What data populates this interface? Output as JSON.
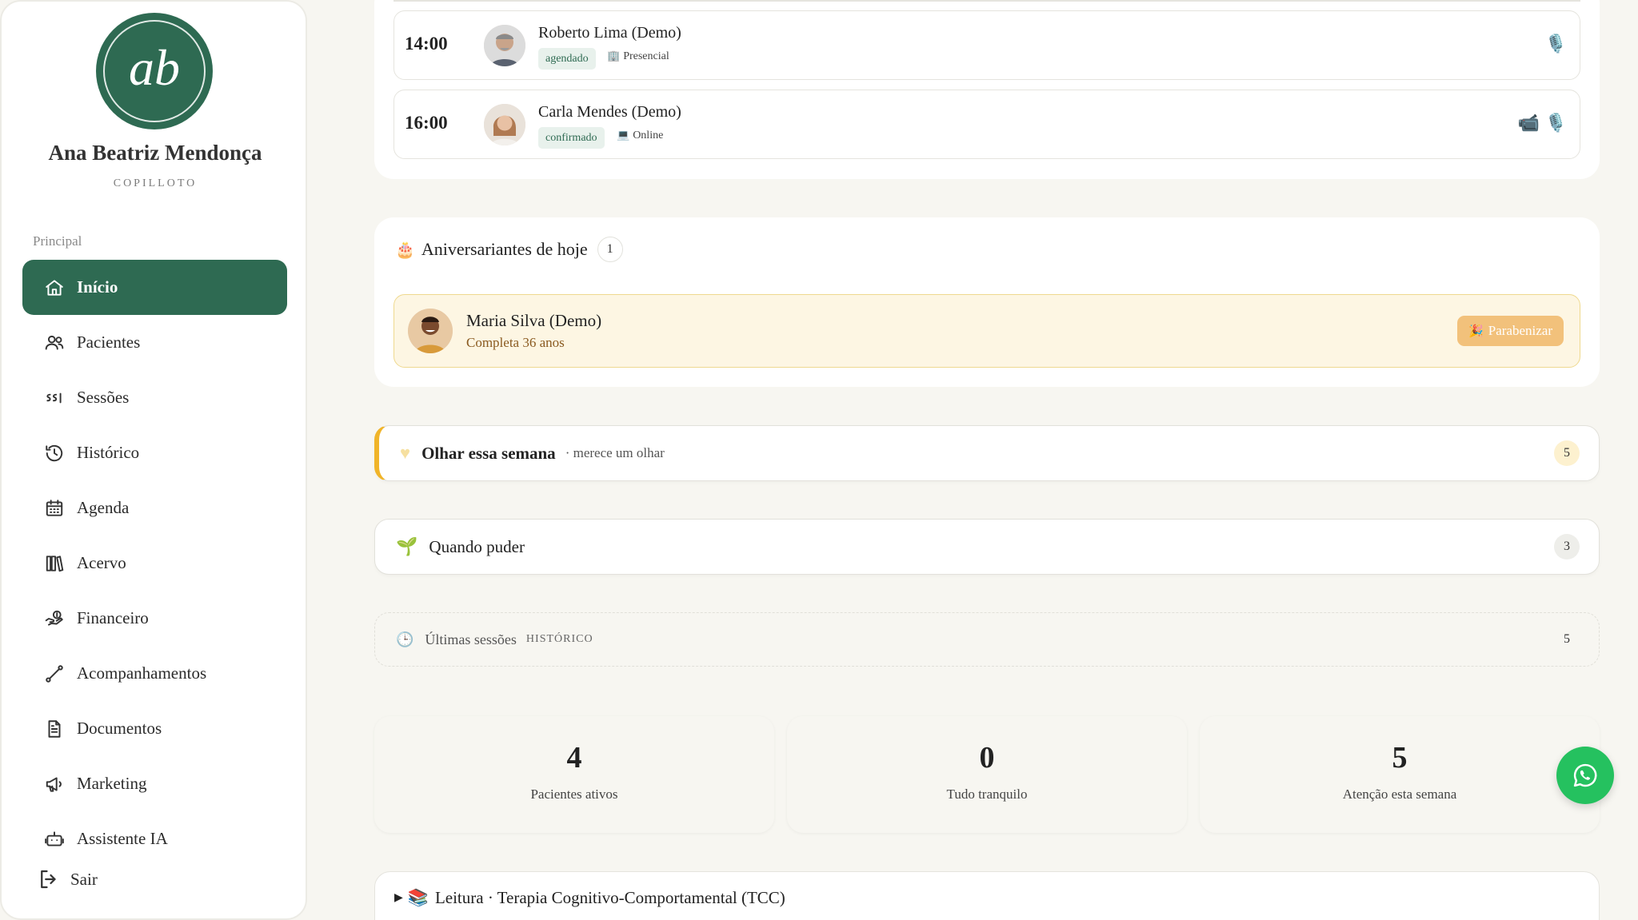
{
  "sidebar": {
    "logo_initials": "ab",
    "user_name": "Ana Beatriz Mendonça",
    "user_role": "COPILLOTO",
    "section_label": "Principal",
    "items": [
      {
        "label": "Início",
        "icon": "home-icon",
        "active": true
      },
      {
        "label": "Pacientes",
        "icon": "users-icon"
      },
      {
        "label": "Sessões",
        "icon": "sessions-icon"
      },
      {
        "label": "Histórico",
        "icon": "history-icon"
      },
      {
        "label": "Agenda",
        "icon": "calendar-icon"
      },
      {
        "label": "Acervo",
        "icon": "library-icon"
      },
      {
        "label": "Financeiro",
        "icon": "finance-icon"
      },
      {
        "label": "Acompanhamentos",
        "icon": "route-icon"
      },
      {
        "label": "Documentos",
        "icon": "document-icon"
      },
      {
        "label": "Marketing",
        "icon": "megaphone-icon"
      },
      {
        "label": "Assistente IA",
        "icon": "robot-icon"
      }
    ],
    "logout_label": "Sair"
  },
  "appointments": [
    {
      "time": "14:00",
      "name": "Roberto Lima (Demo)",
      "status": "agendado",
      "mode": "Presencial",
      "mode_icon": "🏢"
    },
    {
      "time": "16:00",
      "name": "Carla Mendes (Demo)",
      "status": "confirmado",
      "mode": "Online",
      "mode_icon": "💻"
    }
  ],
  "birthdays": {
    "title": "Aniversariantes de hoje",
    "count": "1",
    "person": {
      "name": "Maria Silva (Demo)",
      "detail": "Completa 36 anos"
    },
    "button_label": "Parabenizar"
  },
  "panels": {
    "week": {
      "title": "Olhar essa semana",
      "subtitle": "· merece um olhar",
      "count": "5"
    },
    "soon": {
      "title": "Quando puder",
      "count": "3"
    },
    "history": {
      "title": "Últimas sessões",
      "subtitle": "HISTÓRICO",
      "count": "5"
    }
  },
  "stats": [
    {
      "value": "4",
      "label": "Pacientes ativos"
    },
    {
      "value": "0",
      "label": "Tudo tranquilo"
    },
    {
      "value": "5",
      "label": "Atenção esta semana"
    }
  ],
  "reading": {
    "title": "Leitura · Terapia Cognitivo-Comportamental (TCC)"
  },
  "colors": {
    "brand": "#2e6a52",
    "warning": "#f0b429",
    "whatsapp": "#25c15f"
  }
}
